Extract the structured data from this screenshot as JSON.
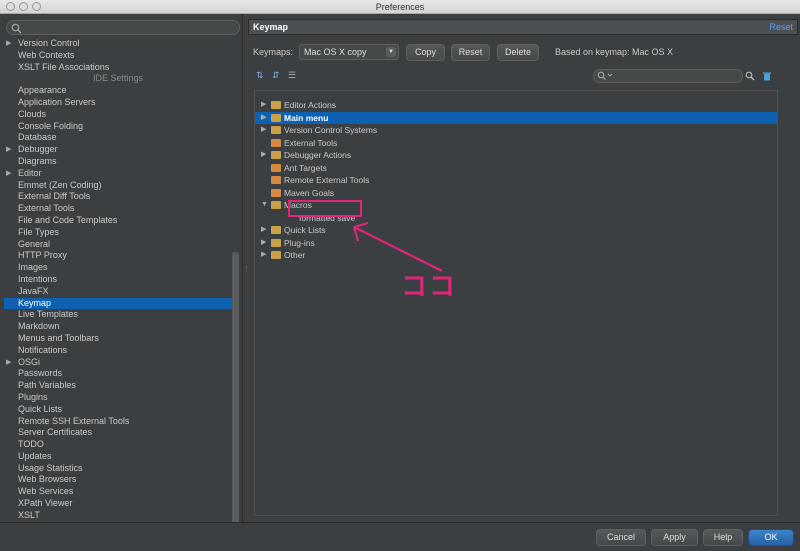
{
  "window": {
    "title": "Preferences"
  },
  "sidebar": {
    "search_placeholder": "",
    "items": [
      {
        "label": "Version Control",
        "arrow": "▶"
      },
      {
        "label": "Web Contexts"
      },
      {
        "label": "XSLT File Associations"
      },
      {
        "label": "IDE Settings",
        "section": true
      },
      {
        "label": "Appearance"
      },
      {
        "label": "Application Servers"
      },
      {
        "label": "Clouds"
      },
      {
        "label": "Console Folding"
      },
      {
        "label": "Database"
      },
      {
        "label": "Debugger",
        "arrow": "▶"
      },
      {
        "label": "Diagrams"
      },
      {
        "label": "Editor",
        "arrow": "▶"
      },
      {
        "label": "Emmet (Zen Coding)"
      },
      {
        "label": "External Diff Tools"
      },
      {
        "label": "External Tools"
      },
      {
        "label": "File and Code Templates"
      },
      {
        "label": "File Types"
      },
      {
        "label": "General"
      },
      {
        "label": "HTTP Proxy"
      },
      {
        "label": "Images"
      },
      {
        "label": "Intentions"
      },
      {
        "label": "JavaFX"
      },
      {
        "label": "Keymap",
        "selected": true
      },
      {
        "label": "Live Templates"
      },
      {
        "label": "Markdown"
      },
      {
        "label": "Menus and Toolbars"
      },
      {
        "label": "Notifications"
      },
      {
        "label": "OSGi",
        "arrow": "▶"
      },
      {
        "label": "Passwords"
      },
      {
        "label": "Path Variables"
      },
      {
        "label": "Plugins"
      },
      {
        "label": "Quick Lists"
      },
      {
        "label": "Remote SSH External Tools"
      },
      {
        "label": "Server Certificates"
      },
      {
        "label": "TODO"
      },
      {
        "label": "Updates"
      },
      {
        "label": "Usage Statistics"
      },
      {
        "label": "Web Browsers"
      },
      {
        "label": "Web Services"
      },
      {
        "label": "XPath Viewer"
      },
      {
        "label": "XSLT"
      }
    ]
  },
  "header": {
    "title": "Keymap",
    "reset": "Reset"
  },
  "keymaps": {
    "label": "Keymaps:",
    "selected": "Mac OS X copy",
    "copy": "Copy",
    "reset": "Reset",
    "delete": "Delete",
    "based_on": "Based on keymap: Mac OS X"
  },
  "actions_tree": [
    {
      "label": "Editor Actions",
      "arrow": "▶",
      "icon": "folder"
    },
    {
      "label": "Main menu",
      "arrow": "▶",
      "icon": "folder",
      "selected": true
    },
    {
      "label": "Version Control Systems",
      "arrow": "▶",
      "icon": "folder"
    },
    {
      "label": "External Tools",
      "icon": "tool"
    },
    {
      "label": "Debugger Actions",
      "arrow": "▶",
      "icon": "folder"
    },
    {
      "label": "Ant Targets",
      "icon": "tool"
    },
    {
      "label": "Remote External Tools",
      "icon": "tool"
    },
    {
      "label": "Maven Goals",
      "icon": "tool"
    },
    {
      "label": "Macros",
      "arrow": "▼",
      "icon": "folder"
    },
    {
      "label": "formatted save",
      "child": true
    },
    {
      "label": "Quick Lists",
      "arrow": "▶",
      "icon": "folder"
    },
    {
      "label": "Plug-ins",
      "arrow": "▶",
      "icon": "folder"
    },
    {
      "label": "Other",
      "arrow": "▶",
      "icon": "folder"
    }
  ],
  "annotation": {
    "text": "ココ",
    "color": "#e0267a"
  },
  "footer": {
    "cancel": "Cancel",
    "apply": "Apply",
    "help": "Help",
    "ok": "OK"
  },
  "colors": {
    "selection": "#0d61b0",
    "accent_link": "#589df6",
    "annotation": "#e0267a"
  }
}
